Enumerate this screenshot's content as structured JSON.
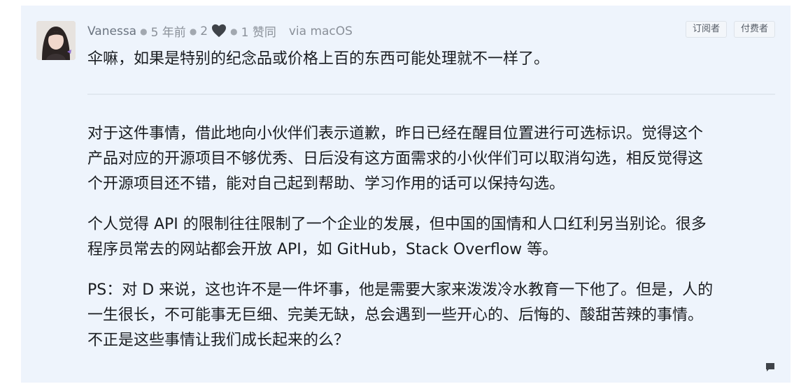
{
  "comment": {
    "author": "Vanessa",
    "time_ago": "5 年前",
    "likes": "2",
    "upvotes": "1 赞同",
    "via": "via macOS",
    "badges": [
      "订阅者",
      "付费者"
    ],
    "reply_text": "伞嘛，如果是特别的纪念品或价格上百的东西可能处理就不一样了。",
    "paragraphs": [
      [
        "对于这件事情，借此地向小伙伴们表示道歉，昨日已经在醒目位置进行可选标识。觉得这个",
        "产品对应的开源项目不够优秀、日后没有这方面需求的小伙伴们可以取消勾选，相反觉得这",
        "个开源项目还不错，能对自己起到帮助、学习作用的话可以保持勾选。"
      ],
      [
        "个人觉得 API 的限制往往限制了一个企业的发展，但中国的国情和人口红利另当别论。很多",
        "程序员常去的网站都会开放 API，如 GitHub，Stack Overflow 等。"
      ],
      [
        "PS：对 D 来说，这也许不是一件坏事，他是需要大家来泼泼冷水教育一下他了。但是，人的",
        "一生很长，不可能事无巨细、完美无缺，总会遇到一些开心的、后悔的、酸甜苦辣的事情。",
        "不正是这些事情让我们成长起来的么？"
      ]
    ]
  },
  "icons": {
    "heart": "heart-icon",
    "comment": "comment-icon"
  },
  "colors": {
    "card_background": "#eef4fc",
    "meta_text": "#8a9099",
    "body_text": "#1a1d21"
  }
}
